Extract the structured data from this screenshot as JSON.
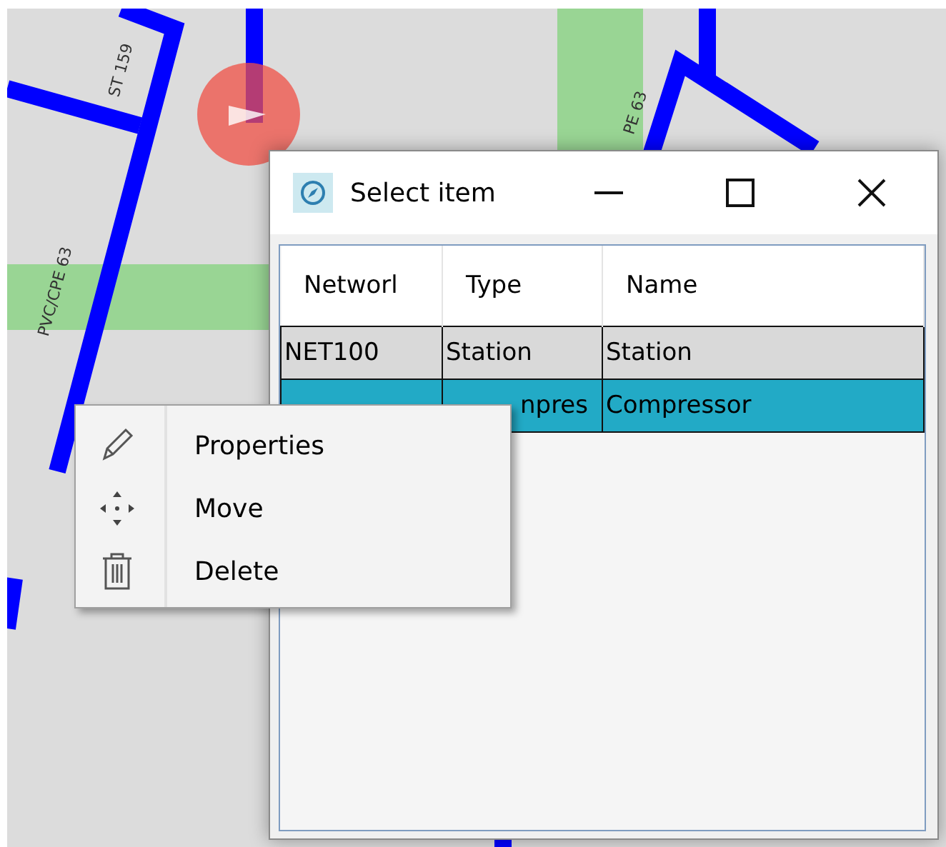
{
  "map": {
    "labels": [
      {
        "text": "ST 159"
      },
      {
        "text": "PVC/CPE 63"
      },
      {
        "text": "PE 63"
      }
    ]
  },
  "dialog": {
    "title": "Select item",
    "controls": [
      {
        "kind": "minimize"
      },
      {
        "kind": "maximize"
      },
      {
        "kind": "close"
      }
    ],
    "columns": [
      "Networl",
      "Type",
      "Name"
    ],
    "rows": [
      {
        "network": "NET100",
        "type": "Station",
        "name": "Station",
        "selected": false
      },
      {
        "type": "npres",
        "name": "Compressor",
        "selected": true
      }
    ]
  },
  "context_menu": {
    "items": [
      {
        "kind": "edit",
        "label": "Properties"
      },
      {
        "kind": "move",
        "label": "Move"
      },
      {
        "kind": "delete",
        "label": "Delete"
      }
    ]
  }
}
